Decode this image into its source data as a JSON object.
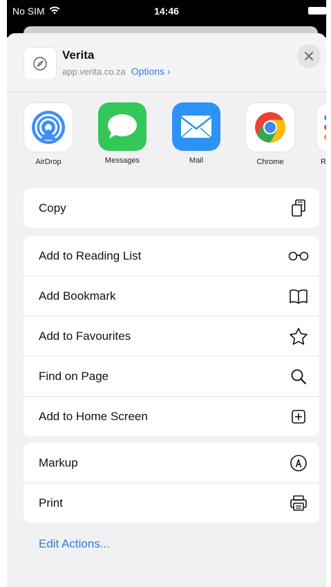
{
  "status": {
    "carrier": "No SIM",
    "time": "14:46"
  },
  "header": {
    "title": "Verita",
    "url": "app.verita.co.za",
    "options_label": "Options ›"
  },
  "apps": [
    {
      "label": "AirDrop",
      "icon": "airdrop-icon"
    },
    {
      "label": "Messages",
      "icon": "messages-icon"
    },
    {
      "label": "Mail",
      "icon": "mail-icon"
    },
    {
      "label": "Chrome",
      "icon": "chrome-icon"
    },
    {
      "label": "Re",
      "icon": "reminders-icon"
    }
  ],
  "groups": {
    "copy": [
      {
        "label": "Copy",
        "icon": "copy-icon"
      }
    ],
    "browser": [
      {
        "label": "Add to Reading List",
        "icon": "glasses-icon"
      },
      {
        "label": "Add Bookmark",
        "icon": "book-icon"
      },
      {
        "label": "Add to Favourites",
        "icon": "star-icon"
      },
      {
        "label": "Find on Page",
        "icon": "search-icon"
      },
      {
        "label": "Add to Home Screen",
        "icon": "plus-square-icon"
      }
    ],
    "other": [
      {
        "label": "Markup",
        "icon": "markup-icon"
      },
      {
        "label": "Print",
        "icon": "printer-icon"
      }
    ]
  },
  "edit_actions_label": "Edit Actions...",
  "colors": {
    "accent": "#2f7be0",
    "sheet_bg": "#f1f1f3"
  }
}
